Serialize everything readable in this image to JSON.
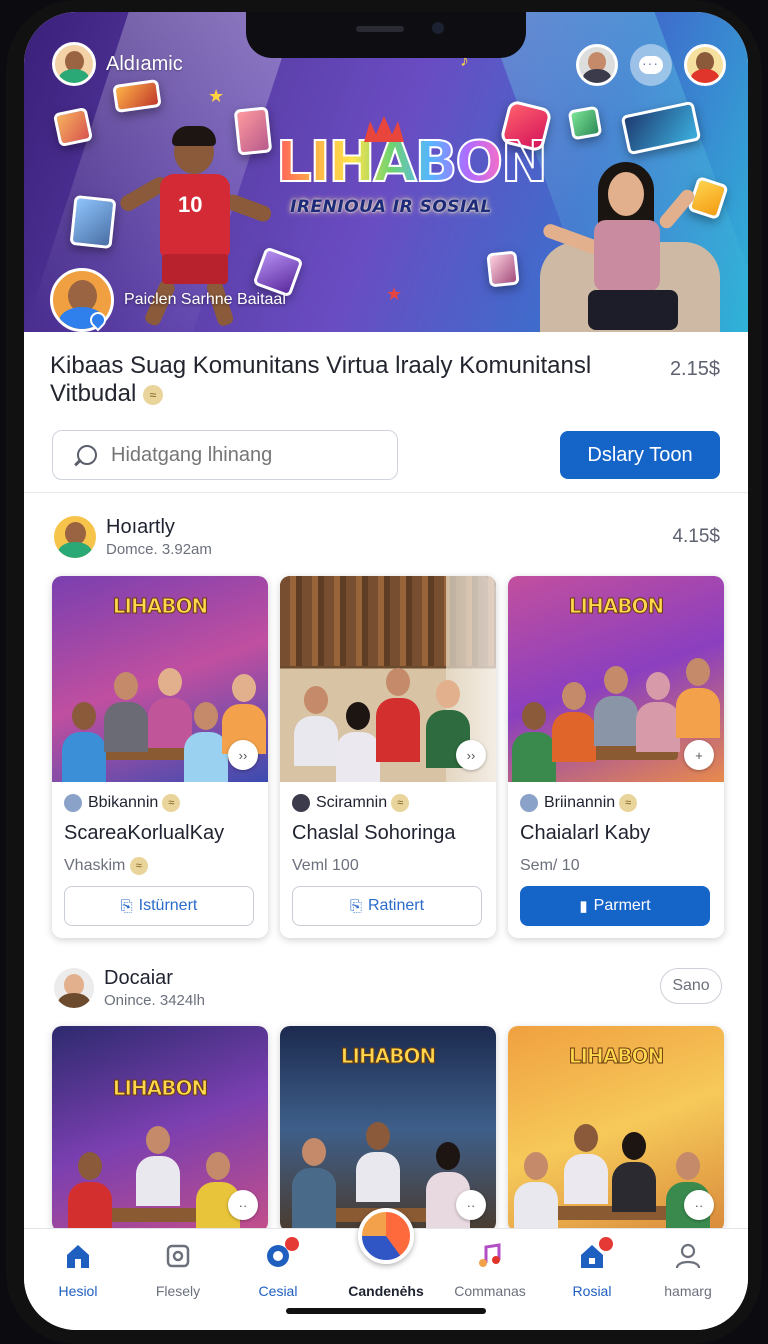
{
  "app": {
    "name": "Aldıamic"
  },
  "hero": {
    "logo_text": "LIHABON",
    "tagline": "IRENIOUA IR SOSIAL",
    "host_label": "Paiclen Sarhne Baitaal"
  },
  "info": {
    "headline": "Kibaas Suag Komunitans Virtua lraaly Komunitansl Vitbudal",
    "price": "2.15$",
    "search_placeholder": "Hidatgang lhinang",
    "primary_button": "Dslary Toon"
  },
  "section1": {
    "title": "Hoıartly",
    "subtitle": "Domce. 3.92am",
    "price": "4.15$",
    "cards": [
      {
        "thumb_logo": "LIHABON",
        "author": "Bbikannin",
        "title": "ScareaKorlualKay",
        "subtitle": "Vhaskim",
        "button": "Istürnert",
        "button_style": "outline"
      },
      {
        "thumb_logo": "",
        "author": "Sciramnin",
        "title": "Chaslal Sohoringa",
        "subtitle": "Veml 100",
        "button": "Ratinert",
        "button_style": "outline"
      },
      {
        "thumb_logo": "LIHABON",
        "author": "Briinannin",
        "title": "Chaialarl Kaby",
        "subtitle": "Sem/ 10",
        "button": "Parmert",
        "button_style": "filled"
      }
    ]
  },
  "section2": {
    "title": "Docaiar",
    "subtitle": "Onince. 3424lh",
    "more_button": "Sano",
    "cards": [
      {
        "thumb_logo": "LIHABON"
      },
      {
        "thumb_logo": "LIHABON"
      },
      {
        "thumb_logo": "LIHABON"
      }
    ]
  },
  "nav": {
    "items": [
      {
        "label": "Hesiol",
        "icon": "home-icon"
      },
      {
        "label": "Flesely",
        "icon": "gallery-icon"
      },
      {
        "label": "Cesial",
        "icon": "gear-icon"
      },
      {
        "label": "Candenėhs",
        "icon": "create-icon"
      },
      {
        "label": "Commanas",
        "icon": "music-note-icon"
      },
      {
        "label": "Rosial",
        "icon": "house-icon"
      },
      {
        "label": "hamarg",
        "icon": "people-icon"
      }
    ]
  },
  "colors": {
    "accent": "#1565c9",
    "nav_active": "#1f5fbf"
  }
}
